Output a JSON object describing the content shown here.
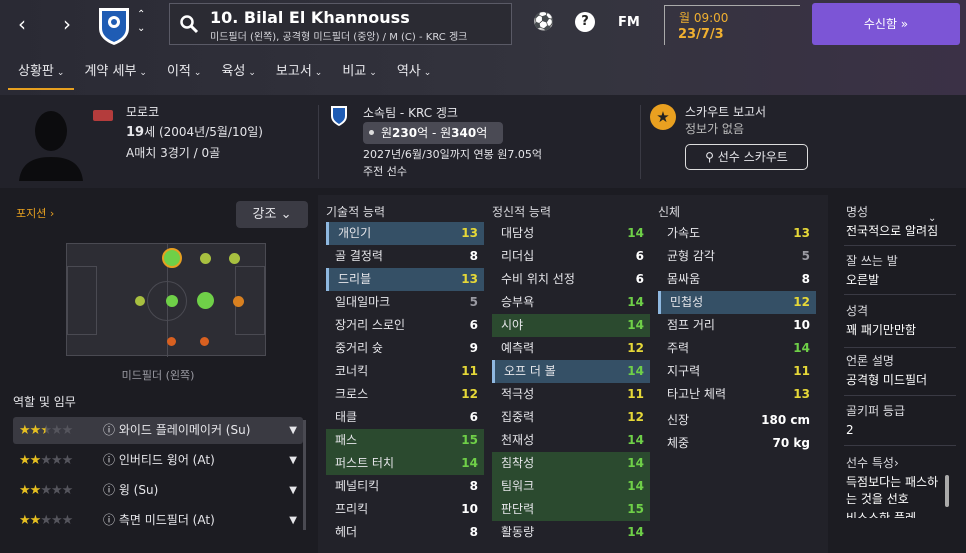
{
  "header": {
    "player_title": "10. Bilal El Khannouss",
    "player_sub": "미드필더 (왼쪽), 공격형 미드필더 (중앙) / M (C) - KRC 겡크",
    "fm_label": "FM",
    "help_label": "?",
    "date_line1": "월 09:00",
    "date_line2": "23/7/3",
    "inbox_label": "수신함 »"
  },
  "menu": [
    "상황판",
    "계약 세부",
    "이적",
    "육성",
    "보고서",
    "비교",
    "역사"
  ],
  "info": {
    "nationality": "모로코",
    "age_num": "19",
    "age_rest": "세 (2004년/5월/10일)",
    "caps": "A매치 3경기 / 0골",
    "club": "소속팀 - KRC 겡크",
    "value_prefix": "원",
    "value_a": "230",
    "value_mid": "억 - 원",
    "value_b": "340",
    "value_suffix": "억",
    "contract": "2027년/6월/30일까지 연봉 원7.05억",
    "squad_status": "주전 선수",
    "scout_title": "스카우트 보고서",
    "scout_sub": "정보가 없음",
    "scout_button": "선수 스카우트"
  },
  "left": {
    "position_title": "포지션 ›",
    "emphasis": "강조 ⌄",
    "position_name": "미드필더 (왼쪽)",
    "roles_header": "역할 및 임무",
    "roles": [
      {
        "name": "ⓘ 와이드 플레이메이커 (Su)",
        "stars": 2.5
      },
      {
        "name": "ⓘ 인버티드 윙어 (At)",
        "stars": 2
      },
      {
        "name": "ⓘ 윙 (Su)",
        "stars": 2
      },
      {
        "name": "ⓘ 측면 미드필더 (At)",
        "stars": 2
      }
    ]
  },
  "attributes": {
    "technical_title": "기술적 능력",
    "mental_title": "정신적 능력",
    "physical_title": "신체",
    "technical": [
      {
        "n": "개인기",
        "v": "13",
        "c": "y",
        "s": "hl"
      },
      {
        "n": "골 결정력",
        "v": "8",
        "c": "w",
        "s": ""
      },
      {
        "n": "드리블",
        "v": "13",
        "c": "y",
        "s": "hl"
      },
      {
        "n": "일대일마크",
        "v": "5",
        "c": "g",
        "s": ""
      },
      {
        "n": "장거리 스로인",
        "v": "6",
        "c": "w",
        "s": ""
      },
      {
        "n": "중거리 슛",
        "v": "9",
        "c": "w",
        "s": ""
      },
      {
        "n": "코너킥",
        "v": "11",
        "c": "y",
        "s": ""
      },
      {
        "n": "크로스",
        "v": "12",
        "c": "y",
        "s": ""
      },
      {
        "n": "태클",
        "v": "6",
        "c": "w",
        "s": ""
      },
      {
        "n": "패스",
        "v": "15",
        "c": "gg",
        "s": "gr"
      },
      {
        "n": "퍼스트 터치",
        "v": "14",
        "c": "gg",
        "s": "gr"
      },
      {
        "n": "페널티킥",
        "v": "8",
        "c": "w",
        "s": ""
      },
      {
        "n": "프리킥",
        "v": "10",
        "c": "w",
        "s": ""
      },
      {
        "n": "헤더",
        "v": "8",
        "c": "w",
        "s": ""
      }
    ],
    "mental": [
      {
        "n": "대담성",
        "v": "14",
        "c": "gg",
        "s": ""
      },
      {
        "n": "리더십",
        "v": "6",
        "c": "w",
        "s": ""
      },
      {
        "n": "수비 위치 선정",
        "v": "6",
        "c": "w",
        "s": ""
      },
      {
        "n": "승부욕",
        "v": "14",
        "c": "gg",
        "s": ""
      },
      {
        "n": "시야",
        "v": "14",
        "c": "gg",
        "s": "gr"
      },
      {
        "n": "예측력",
        "v": "12",
        "c": "y",
        "s": ""
      },
      {
        "n": "오프 더 볼",
        "v": "14",
        "c": "gg",
        "s": "hl"
      },
      {
        "n": "적극성",
        "v": "11",
        "c": "y",
        "s": ""
      },
      {
        "n": "집중력",
        "v": "12",
        "c": "y",
        "s": ""
      },
      {
        "n": "천재성",
        "v": "14",
        "c": "gg",
        "s": ""
      },
      {
        "n": "침착성",
        "v": "14",
        "c": "gg",
        "s": "gr"
      },
      {
        "n": "팀워크",
        "v": "14",
        "c": "gg",
        "s": "gr"
      },
      {
        "n": "판단력",
        "v": "15",
        "c": "gg",
        "s": "gr"
      },
      {
        "n": "활동량",
        "v": "14",
        "c": "gg",
        "s": ""
      }
    ],
    "physical": [
      {
        "n": "가속도",
        "v": "13",
        "c": "y",
        "s": ""
      },
      {
        "n": "균형 감각",
        "v": "5",
        "c": "g",
        "s": ""
      },
      {
        "n": "몸싸움",
        "v": "8",
        "c": "w",
        "s": ""
      },
      {
        "n": "민첩성",
        "v": "12",
        "c": "y",
        "s": "hl"
      },
      {
        "n": "점프 거리",
        "v": "10",
        "c": "w",
        "s": ""
      },
      {
        "n": "주력",
        "v": "14",
        "c": "gg",
        "s": ""
      },
      {
        "n": "지구력",
        "v": "11",
        "c": "y",
        "s": ""
      },
      {
        "n": "타고난 체력",
        "v": "13",
        "c": "y",
        "s": ""
      }
    ],
    "height_label": "신장",
    "height": "180 cm",
    "weight_label": "체중",
    "weight": "70 kg"
  },
  "right": {
    "reputation_title": "명성",
    "reputation": "전국적으로 알려짐",
    "foot_title": "잘 쓰는 발",
    "foot": "오른발",
    "personality_title": "성격",
    "personality": "꽤 패기만만함",
    "media_title": "언론 설명",
    "media": "공격형 미드필더",
    "goalkeeper_title": "골키퍼 등급",
    "goalkeeper": "2",
    "traits_title": "선수 특성›",
    "traits": "득점보다는 패스하는 것을 선호",
    "traits_more": "비스스한 플레"
  },
  "colors": {
    "accent": "#e7a020",
    "inbox": "#7c55d6",
    "high": "#6fd048",
    "mid": "#e6d838",
    "low": "#9a9aa2"
  }
}
